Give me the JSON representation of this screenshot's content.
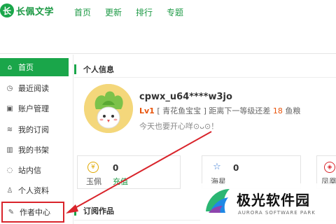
{
  "logo": {
    "mark": "长",
    "text": "长佩文学"
  },
  "nav": [
    {
      "label": "首页"
    },
    {
      "label": "更新"
    },
    {
      "label": "排行"
    },
    {
      "label": "专题"
    }
  ],
  "sidebar": {
    "items": [
      {
        "label": "首页",
        "icon": "home-icon",
        "glyph": "⌂",
        "active": true
      },
      {
        "label": "最近阅读",
        "icon": "clock-icon",
        "glyph": "◷"
      },
      {
        "label": "账户管理",
        "icon": "account-icon",
        "glyph": "▣"
      },
      {
        "label": "我的订阅",
        "icon": "rss-icon",
        "glyph": "≋"
      },
      {
        "label": "我的书架",
        "icon": "books-icon",
        "glyph": "▥"
      },
      {
        "label": "站内信",
        "icon": "message-icon",
        "glyph": "◌"
      },
      {
        "label": "个人资料",
        "icon": "user-icon",
        "glyph": "♙"
      },
      {
        "label": "作者中心",
        "icon": "pencil-icon",
        "glyph": "✎",
        "highlighted": true
      }
    ]
  },
  "profile": {
    "section_title": "个人信息",
    "username": "cpwx_u64****w3jo",
    "level": "Lv1",
    "level_title": "[ 青花鱼宝宝 ]",
    "next_text_prefix": "距离下一等级还差",
    "next_amount": "18",
    "next_unit": "鱼粮",
    "mood": "今天也要开心咩⊙ᴗ⊙！"
  },
  "stats": [
    {
      "icon": "coin-icon",
      "glyph": "¥",
      "label": "玉佩",
      "value": "0",
      "link": "充值"
    },
    {
      "icon": "star-icon",
      "glyph": "☆",
      "label": "海星",
      "value": "0"
    },
    {
      "icon": "badge-icon",
      "glyph": "◈",
      "label": "凤凰"
    }
  ],
  "works": {
    "section_title": "订阅作品"
  },
  "watermark": {
    "cn": "极光软件园",
    "en": "AURORA SOFTWARE PARK"
  },
  "colors": {
    "brand": "#1aa64a",
    "highlight": "#d9242b",
    "accent": "#e8540b"
  }
}
